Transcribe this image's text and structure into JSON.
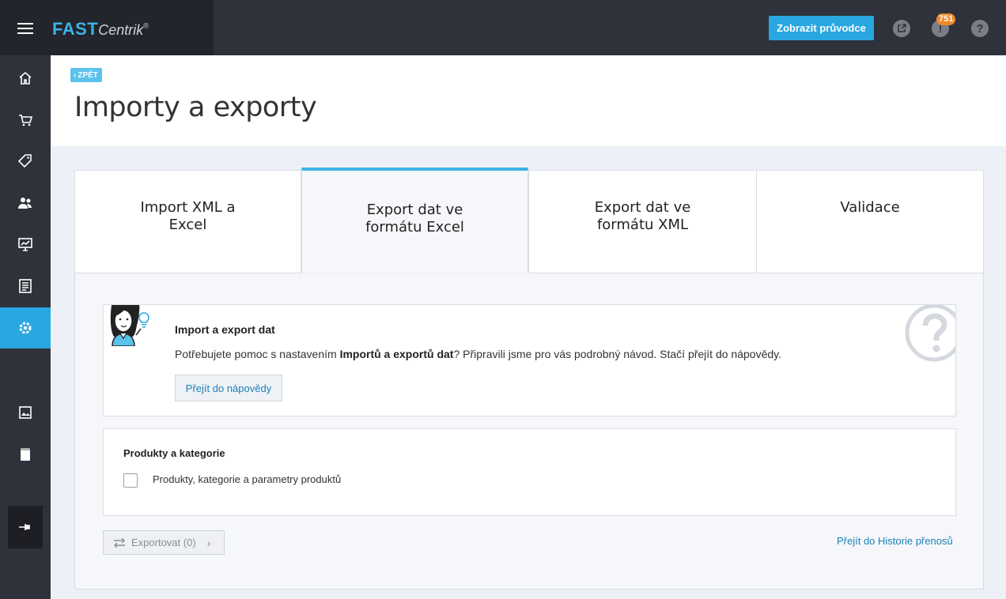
{
  "app": {
    "logo_main": "FAST",
    "logo_sub": "Centrik",
    "logo_mark": "®"
  },
  "topbar": {
    "guide_button": "Zobrazit průvodce",
    "notification_count": "751",
    "icons": [
      "external-link-icon",
      "notification-icon",
      "help-icon"
    ]
  },
  "sidebar": {
    "items": [
      {
        "icon": "home-icon"
      },
      {
        "icon": "cart-icon"
      },
      {
        "icon": "tag-icon"
      },
      {
        "icon": "users-icon"
      },
      {
        "icon": "stats-icon"
      },
      {
        "icon": "document-icon"
      },
      {
        "icon": "settings-icon",
        "active": true
      },
      {
        "icon": "gallery-icon"
      },
      {
        "icon": "book-icon"
      },
      {
        "icon": "pin-icon"
      }
    ]
  },
  "header": {
    "back_label": "ZPĚT",
    "title": "Importy a exporty"
  },
  "tabs": [
    {
      "label": "Import XML a Excel"
    },
    {
      "label": "Export dat ve formátu Excel",
      "active": true
    },
    {
      "label": "Export dat ve formátu XML"
    },
    {
      "label": "Validace"
    }
  ],
  "help": {
    "title": "Import a export dat",
    "text_before": "Potřebujete pomoc s nastavením ",
    "text_bold": "Importů a exportů dat",
    "text_after": "? Připravili jsme pro vás podrobný návod. Stačí přejít do nápovědy.",
    "button": "Přejít do nápovědy"
  },
  "products": {
    "title": "Produkty a kategorie",
    "checkbox_label": "Produkty, kategorie a parametry produktů",
    "checked": false
  },
  "footer": {
    "export_button": "Exportovat (0)",
    "history_link": "Přejít do Historie přenosů"
  },
  "colors": {
    "accent": "#29a7e1",
    "topbar": "#2f323a",
    "badge": "#f0892b"
  }
}
